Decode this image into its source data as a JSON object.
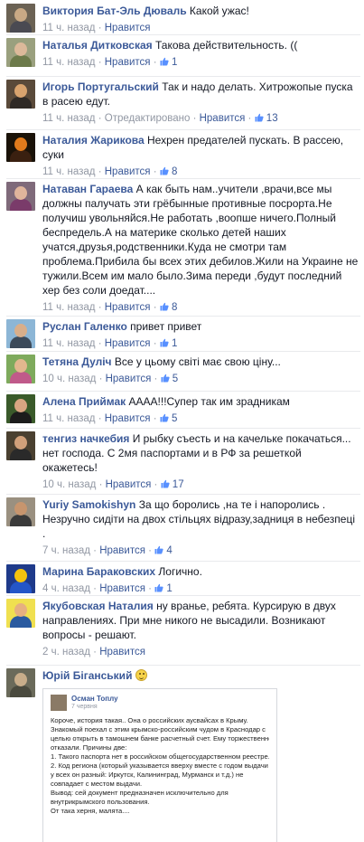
{
  "colors": {
    "link": "#3b5998",
    "meta": "#9197a3",
    "text": "#141823",
    "divider": "#e9eaed"
  },
  "comments": [
    {
      "author": "Виктория Бат-Эль Дюваль",
      "text": "Какой ужас!",
      "time": "11 ч. назад",
      "like_label": "Нравится",
      "likes": ""
    },
    {
      "author": "Наталья Дитковская",
      "text": "Такова действительность. ((",
      "time": "11 ч. назад",
      "like_label": "Нравится",
      "likes": "1"
    },
    {
      "author": "Игорь Португальский",
      "text": "Так и надо делать. Хитрожопые пуска в расею едут.",
      "time": "11 ч. назад",
      "edited": "Отредактировано",
      "like_label": "Нравится",
      "likes": "13"
    },
    {
      "author": "Наталия Жарикова",
      "text": "Нехрен предателей пускать. В рассею, суки",
      "time": "11 ч. назад",
      "like_label": "Нравится",
      "likes": "8"
    },
    {
      "author": "Натаван Гараева",
      "text": "А как быть нам..учители ,врачи,все мы должны пaлучать эти грёбынные противные посрорта.Не получиш увольняйся.Не работать ,воопше ничего.Полный беспредель.А на материке сколько детей наших учатся,друзья,родственники.Куда не смотри там проблема.Прибила бы всех этих дебилов.Жили на Украине не тужили.Всем им мало было.Зима переди ,будут последний хер без соли доедат....",
      "time": "11 ч. назад",
      "like_label": "Нравится",
      "likes": "8"
    },
    {
      "author": "Руслан Галенко",
      "text": "привет привет",
      "time": "11 ч. назад",
      "like_label": "Нравится",
      "likes": "1"
    },
    {
      "author": "Тетяна Дуліч",
      "text": "Все у цьому світі має свою ціну...",
      "time": "10 ч. назад",
      "like_label": "Нравится",
      "likes": "5"
    },
    {
      "author": "Алена Приймак",
      "text": "АААА!!!Супер так им зрадникам",
      "time": "11 ч. назад",
      "like_label": "Нравится",
      "likes": "5"
    },
    {
      "author": "тенгиз начкебия",
      "text": "И рыбку съесть и на качельке покачаться... нет господа. С 2мя паспортами и в РФ за решеткой окажетесь!",
      "time": "10 ч. назад",
      "like_label": "Нравится",
      "likes": "17"
    },
    {
      "author": "Yuriy Samokishyn",
      "text": "За що боролись ,на те і напоролись . Незручно сидіти на двох стільцях відразу,задниця в небезпеці .",
      "time": "7 ч. назад",
      "like_label": "Нравится",
      "likes": "4"
    },
    {
      "author": "Марина Бараковских",
      "text": "Логично.",
      "time": "4 ч. назад",
      "like_label": "Нравится",
      "likes": "1"
    },
    {
      "author": "Якубовская Наталия",
      "text": "ну вранье, ребята. Курсирую в двух направлениях. При мне никого не высадили. Возникают вопросы - решают.",
      "time": "2 ч. назад",
      "like_label": "Нравится",
      "likes": ""
    },
    {
      "author": "Юрій Біганський",
      "text": "",
      "time": "2 ч. назад",
      "like_label": "Нравится",
      "likes": "2",
      "emoji_icon": "smiley-icon",
      "attachment": {
        "name": "Осман Топлу",
        "date": "7 червня",
        "lines": [
          "Короче, история такая.. Она о российских аусвайсах в Крыму.",
          "Знакомый поехал с этим крымско-российским чудом в Краснодар с",
          "целью открыть в тамошнем банке расчетный счет. Ему торжественно",
          "отказали. Причины две:",
          "1. Такого паспорта нет в российском общегосударственном реестре.",
          "2. Код региона (который указывается вверху вместе с годом выдачи и",
          "у всех он разный: Иркутск, Калининград, Мурманск и т.д.) не",
          "совпадает с местом выдачи.",
          "Вывод: сей документ предназначен исключительно для",
          "внутрикрымского пользования.",
          "От така херня, малята...."
        ]
      }
    }
  ]
}
